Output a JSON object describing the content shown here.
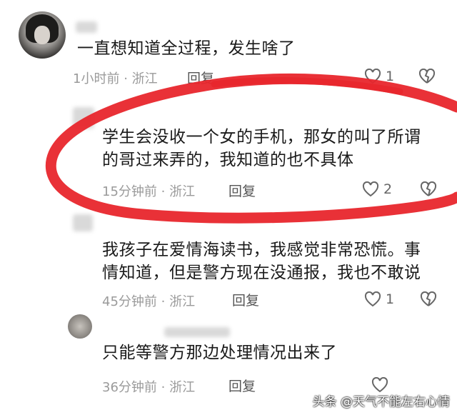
{
  "comments": [
    {
      "text": "一直想知道全过程，发生啥了",
      "time": "1小时前",
      "location": "浙江",
      "reply_label": "回复",
      "likes": "1"
    },
    {
      "lines": [
        "学生会没收一个女的手机，那女的叫了所谓",
        "的哥过来弄的，我知道的也不具体"
      ],
      "time": "15分钟前",
      "location": "浙江",
      "reply_label": "回复",
      "likes": "2"
    },
    {
      "lines": [
        "我孩子在爱情海读书，我感觉非常恐慌。事",
        "情知道，但是警方现在没通报，我也不敢说"
      ],
      "time": "45分钟前",
      "location": "浙江",
      "reply_label": "回复",
      "likes": "1"
    },
    {
      "text": "只能等警方那边处理情况出来了",
      "time": "36分钟前",
      "location": "浙江",
      "reply_label": "回复"
    }
  ],
  "separator": "·",
  "watermark": "头条 @天气不能左右心情",
  "annotation_color": "#e8262c"
}
